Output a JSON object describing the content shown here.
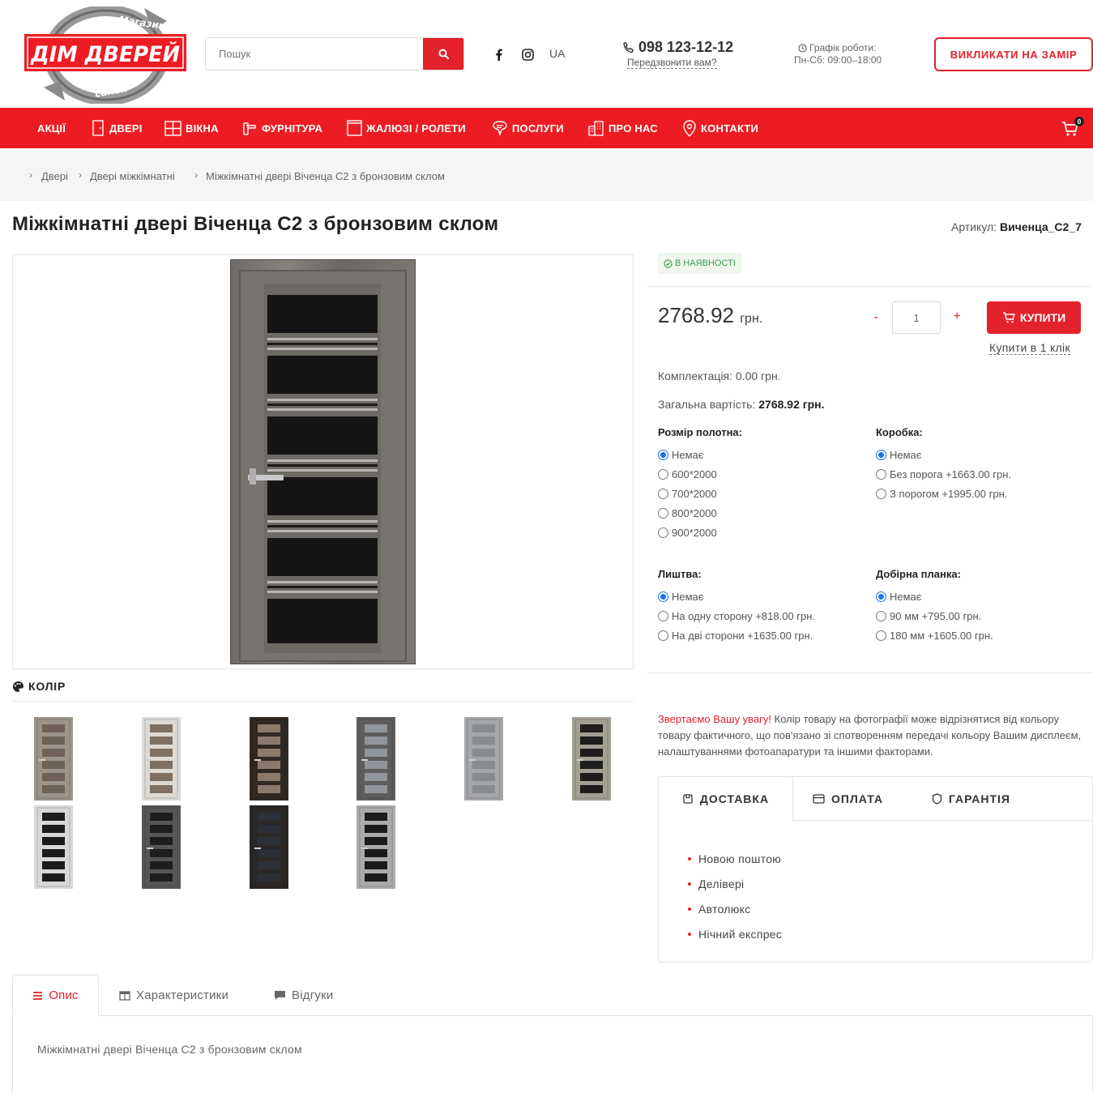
{
  "brand": {
    "logo_main": "ДІМ ДВЕРЕЙ",
    "logo_top": "Магазин",
    "logo_bottom": "салон",
    "accent": "#ed1c24"
  },
  "header": {
    "search_placeholder": "Пошук",
    "search_icon": "search-icon",
    "social": [
      "facebook-icon",
      "instagram-icon"
    ],
    "lang": "UA",
    "phone": "098 123-12-12",
    "callback": "Передзвонити вам?",
    "schedule_title": "Графік роботи:",
    "schedule_hours": "Пн-Сб: 09:00–18:00",
    "cta": "ВИКЛИКАТИ НА ЗАМІР"
  },
  "nav": {
    "items": [
      {
        "label": "АКЦІЇ",
        "icon": ""
      },
      {
        "label": "ДВЕРІ",
        "icon": "door-icon"
      },
      {
        "label": "ВІКНА",
        "icon": "window-icon"
      },
      {
        "label": "ФУРНІТУРА",
        "icon": "handle-icon"
      },
      {
        "label": "ЖАЛЮЗІ / РОЛЕТИ",
        "icon": "blinds-icon"
      },
      {
        "label": "ПОСЛУГИ",
        "icon": "services-icon"
      },
      {
        "label": "ПРО НАС",
        "icon": "building-icon"
      },
      {
        "label": "КОНТАКТИ",
        "icon": "location-icon"
      }
    ],
    "cart_count": "0"
  },
  "breadcrumb": [
    "Двері",
    "Двері міжкімнатні",
    "Міжкімнатні двері Віченца С2 з бронзовим склом"
  ],
  "product": {
    "title": "Міжкімнатні двері Віченца С2 з бронзовим склом",
    "sku_label": "Артикул:",
    "sku": "Виченца_С2_7",
    "stock": "В НАЯВНОСТІ",
    "price": "2768.92",
    "currency": "грн.",
    "qty": "1",
    "qty_minus": "-",
    "qty_plus": "+",
    "buy": "КУПИТИ",
    "one_click": "Купити в 1 клік",
    "kompl_label": "Комплектація:",
    "kompl_value": "0.00 грн.",
    "total_label": "Загальна вартість:",
    "total_value": "2768.92 грн."
  },
  "colors": {
    "title": "КОЛІР",
    "swatches": [
      {
        "frame": "#9b948a",
        "glass": "#6e6257"
      },
      {
        "frame": "#dcdad5",
        "glass": "#7e7163"
      },
      {
        "frame": "#2e2924",
        "glass": "#8a7a6b"
      },
      {
        "frame": "#5f5d5c",
        "glass": "#8f959b"
      },
      {
        "frame": "#a5a6a9",
        "glass": "#888c91"
      },
      {
        "frame": "#a39f93",
        "glass": "#1d1d1d"
      },
      {
        "frame": "#d8d8d6",
        "glass": "#1c1c1c"
      },
      {
        "frame": "#575655",
        "glass": "#1e1e1e"
      },
      {
        "frame": "#2b2724",
        "glass": "#2b2f37"
      },
      {
        "frame": "#aaaaaa",
        "glass": "#1b1b1b"
      }
    ]
  },
  "options": {
    "size": {
      "title": "Розмір полотна:",
      "values": [
        "Немає",
        "600*2000",
        "700*2000",
        "800*2000",
        "900*2000"
      ],
      "selected": 0
    },
    "box": {
      "title": "Коробка:",
      "values": [
        "Немає",
        "Без порога +1663.00 грн.",
        "З порогом +1995.00 грн."
      ],
      "selected": 0
    },
    "trim": {
      "title": "Лиштва:",
      "values": [
        "Немає",
        "На одну сторону +818.00 грн.",
        "На дві сторони +1635.00 грн."
      ],
      "selected": 0
    },
    "extension": {
      "title": "Добірна планка:",
      "values": [
        "Немає",
        "90 мм +795.00 грн.",
        "180 мм +1605.00 грн."
      ],
      "selected": 0
    }
  },
  "notice": {
    "attention": "Звертаємо Вашу увагу!",
    "text": " Колір товару на фотографії може відрізнятися від кольору товару фактичного, що пов'язано зі спотворенням передачі кольору Вашим дисплеєм, налаштуваннями фотоапаратури та іншими факторами."
  },
  "delivery_tabs": {
    "tabs": [
      "ДОСТАВКА",
      "ОПЛАТА",
      "ГАРАНТІЯ"
    ],
    "active": 0,
    "items": [
      "Новою поштою",
      "Делівері",
      "Автолюкс",
      "Нічний експрес"
    ]
  },
  "bottom_tabs": {
    "tabs": [
      "Опис",
      "Характеристики",
      "Відгуки"
    ],
    "active": 0,
    "description": "Міжкімнатні двері Віченца С2 з бронзовим склом"
  }
}
